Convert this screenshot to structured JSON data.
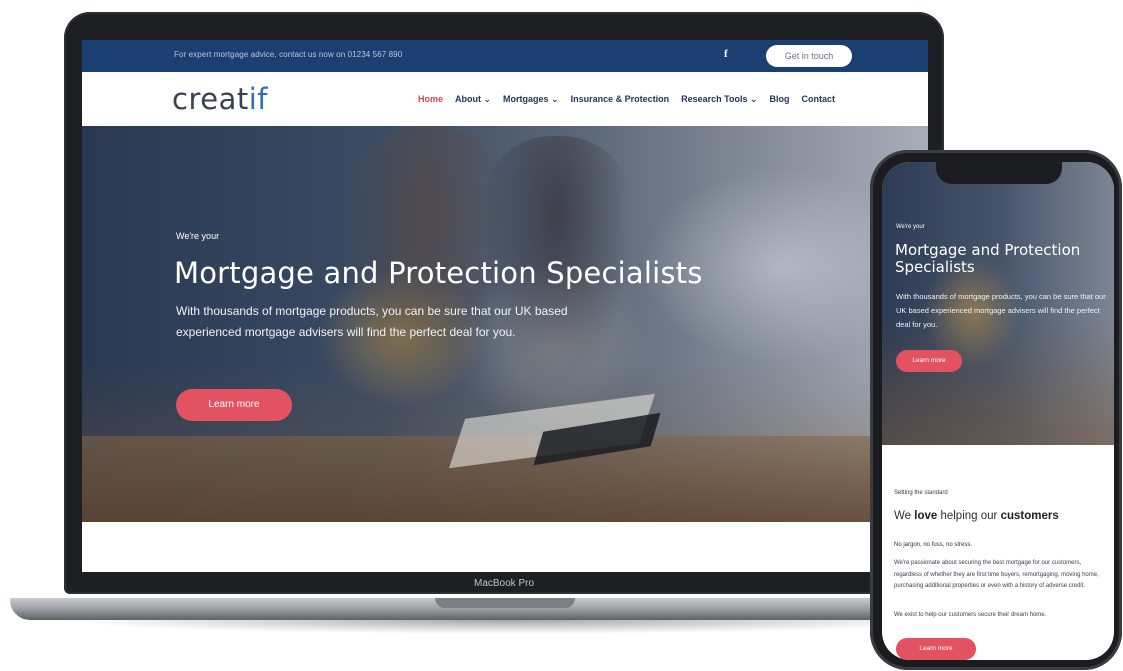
{
  "laptop": {
    "device_label": "MacBook Pro",
    "topbar": {
      "text": "For expert mortgage advice, contact us now on 01234 567 890",
      "facebook_icon": "f",
      "cta": "Get in touch"
    },
    "logo": {
      "part1": "creat",
      "part2": "if"
    },
    "nav": [
      {
        "label": "Home",
        "active": true
      },
      {
        "label": "About ⌄"
      },
      {
        "label": "Mortgages ⌄"
      },
      {
        "label": "Insurance & Protection"
      },
      {
        "label": "Research Tools ⌄"
      },
      {
        "label": "Blog"
      },
      {
        "label": "Contact"
      }
    ],
    "hero": {
      "pretitle": "We're your",
      "title": "Mortgage and Protection Specialists",
      "body": "With thousands of mortgage products, you can be sure that our UK based experienced mortgage advisers will find the perfect deal for you.",
      "cta": "Learn more"
    }
  },
  "phone": {
    "hero": {
      "pretitle": "We're your",
      "title": "Mortgage and Protection Specialists",
      "body": "With thousands of mortgage products, you can be sure that our UK based experienced mortgage advisers will find the perfect deal for you.",
      "cta": "Learn more"
    },
    "section": {
      "pretitle": "Setting the standard",
      "heading_part1": "We ",
      "heading_bold1": "love",
      "heading_part2": " helping our ",
      "heading_bold2": "customers",
      "subheading": "No jargon, no fuss, no stress.",
      "paragraph": "We're passionate about securing the best mortgage for our customers, regardless of whether they are first time buyers, remortgaging, moving home, purchasing additional properties or even with a history of adverse credit.",
      "paragraph2": "We exist to help our customers secure their dream home.",
      "cta": "Learn more"
    }
  },
  "colors": {
    "topbar": "#1c3f73",
    "accent_cta": "#e35260",
    "nav_active": "#d9434f",
    "logo_accent": "#2f6fbf"
  }
}
